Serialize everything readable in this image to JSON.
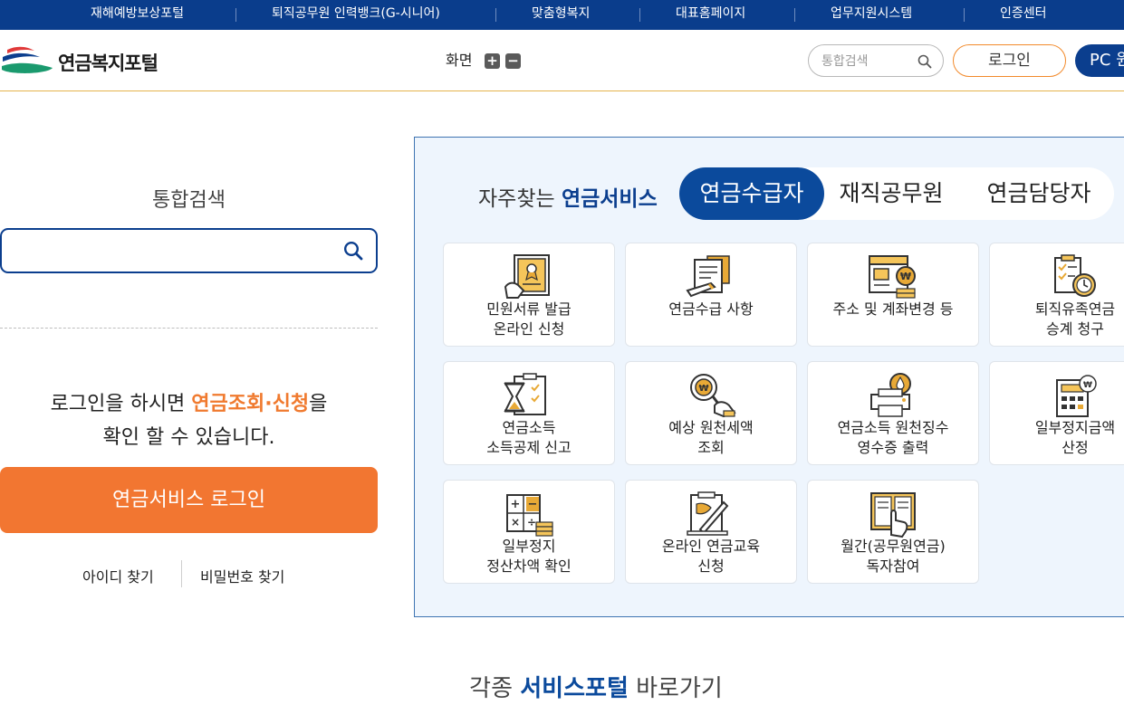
{
  "topbar": {
    "links": [
      "재해예방보상포털",
      "퇴직공무원 인력뱅크(G-시니어)",
      "맞춤형복지",
      "대표홈페이지",
      "업무지원시스템",
      "인증센터"
    ]
  },
  "header": {
    "logo_text": "연금복지포털",
    "zoom_label": "화면",
    "zoom_in": "+",
    "zoom_out": "−",
    "search_placeholder": "통합검색",
    "login": "로그인",
    "pc_version": "PC 원"
  },
  "left": {
    "search_title": "통합검색",
    "search_value": "",
    "msg_pre": "로그인을 하시면 ",
    "msg_highlight": "연금조회·신청",
    "msg_post": "을",
    "msg_line2": "확인 할 수 있습니다.",
    "login_button": "연금서비스 로그인",
    "find_id": "아이디 찾기",
    "find_pw": "비밀번호 찾기"
  },
  "services": {
    "title_pre": "자주찾는 ",
    "title_bold": "연금서비스",
    "tabs": [
      "연금수급자",
      "재직공무원",
      "연금담당자"
    ],
    "active_tab": "연금수급자",
    "cards": [
      {
        "label": "민원서류 발급\n온라인 신청",
        "icon": "certificate-icon"
      },
      {
        "label": "연금수급 사항",
        "icon": "document-pen-icon"
      },
      {
        "label": "주소 및 계좌변경 등",
        "icon": "bank-account-icon"
      },
      {
        "label": "퇴직유족연금\n승계 청구",
        "icon": "checklist-clock-icon"
      },
      {
        "label": "연금소득\n소득공제 신고",
        "icon": "hourglass-checklist-icon"
      },
      {
        "label": "예상 원천세액\n조회",
        "icon": "magnifier-coin-icon"
      },
      {
        "label": "연금소득 원천징수\n영수증 출력",
        "icon": "printer-drop-icon"
      },
      {
        "label": "일부정지금액\n산정",
        "icon": "calculator-coin-icon"
      },
      {
        "label": "일부정지\n정산차액 확인",
        "icon": "calculator-coins-icon"
      },
      {
        "label": "온라인 연금교육\n신청",
        "icon": "book-pencil-icon"
      },
      {
        "label": "월간(공무원연금)\n독자참여",
        "icon": "magazine-hand-icon"
      }
    ]
  },
  "bottom": {
    "title_pre": "각종 ",
    "title_bold": "서비스포털",
    "title_post": " 바로가기"
  },
  "colors": {
    "navy": "#0b3e8e",
    "orange": "#f27631",
    "panel_bg": "#eef5fd",
    "icon_gold": "#e8a936"
  }
}
